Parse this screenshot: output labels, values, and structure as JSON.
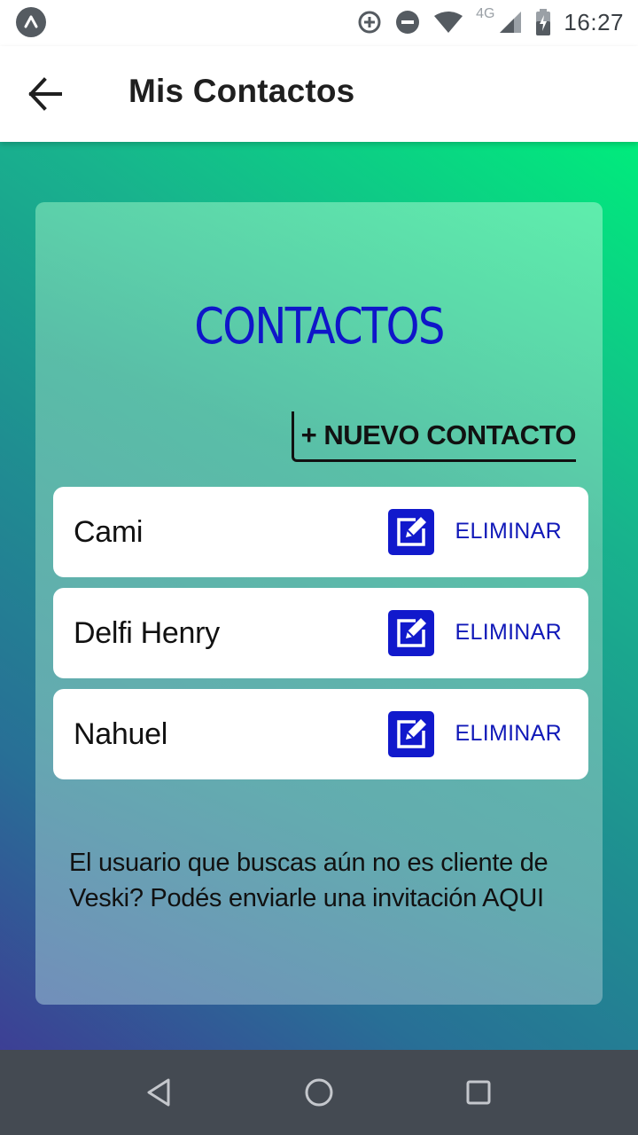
{
  "status_bar": {
    "network_type": "4G",
    "time": "16:27"
  },
  "app_bar": {
    "title": "Mis Contactos"
  },
  "card": {
    "heading": "CONTACTOS",
    "new_contact_label": "+ NUEVO CONTACTO",
    "contacts": [
      {
        "name": "Cami",
        "delete_label": "ELIMINAR"
      },
      {
        "name": "Delfi Henry",
        "delete_label": "ELIMINAR"
      },
      {
        "name": "Nahuel",
        "delete_label": "ELIMINAR"
      }
    ],
    "invite_text": "El usuario que buscas aún no es cliente de Veski? Podés enviarle una invitación AQUI"
  },
  "colors": {
    "accent_blue": "#0f16c9",
    "gradient_top": "#00ec7c",
    "gradient_bottom": "#3d3f95",
    "nav_bar": "#444a52"
  },
  "icons": {
    "status_left": "app-notification-icon",
    "status_right": [
      "data-saver-icon",
      "do-not-disturb-icon",
      "wifi-icon",
      "signal-icon",
      "battery-charging-icon"
    ],
    "back": "arrow-back-icon",
    "edit": "edit-pencil-icon",
    "nav": [
      "back-triangle-icon",
      "home-circle-icon",
      "recents-square-icon"
    ]
  }
}
